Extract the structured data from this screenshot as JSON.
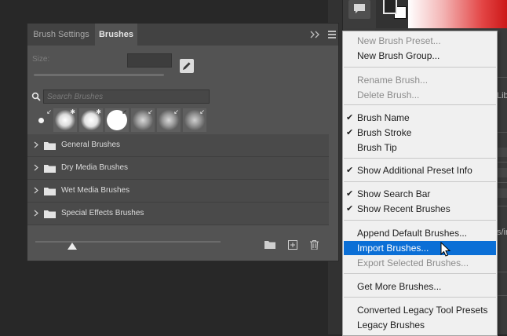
{
  "panel": {
    "tabs": [
      "Brush Settings",
      "Brushes"
    ],
    "active_tab": "Brushes",
    "size_label": "Size:",
    "search_placeholder": "Search Brushes",
    "brush_groups": [
      "General Brushes",
      "Dry Media Brushes",
      "Wet Media Brushes",
      "Special Effects Brushes"
    ],
    "preview_level": 0.2
  },
  "menu": {
    "items": [
      {
        "label": "New Brush Preset...",
        "enabled": false,
        "checked": false
      },
      {
        "label": "New Brush Group...",
        "enabled": true,
        "checked": false
      },
      {
        "label": "Rename Brush...",
        "enabled": false,
        "checked": false
      },
      {
        "label": "Delete Brush...",
        "enabled": false,
        "checked": false
      },
      {
        "label": "Brush Name",
        "enabled": true,
        "checked": true
      },
      {
        "label": "Brush Stroke",
        "enabled": true,
        "checked": true
      },
      {
        "label": "Brush Tip",
        "enabled": true,
        "checked": false
      },
      {
        "label": "Show Additional Preset Info",
        "enabled": true,
        "checked": true
      },
      {
        "label": "Show Search Bar",
        "enabled": true,
        "checked": true
      },
      {
        "label": "Show Recent Brushes",
        "enabled": true,
        "checked": true
      },
      {
        "label": "Append Default Brushes...",
        "enabled": true,
        "checked": false
      },
      {
        "label": "Import Brushes...",
        "enabled": true,
        "checked": false,
        "highlighted": true
      },
      {
        "label": "Export Selected Brushes...",
        "enabled": false,
        "checked": false
      },
      {
        "label": "Get More Brushes...",
        "enabled": true,
        "checked": false
      },
      {
        "label": "Converted Legacy Tool Presets",
        "enabled": true,
        "checked": false
      },
      {
        "label": "Legacy Brushes",
        "enabled": true,
        "checked": false
      }
    ],
    "highlight_color": "#0b6fd6"
  },
  "background": {
    "fragments": [
      "Libr",
      "s/in"
    ]
  }
}
